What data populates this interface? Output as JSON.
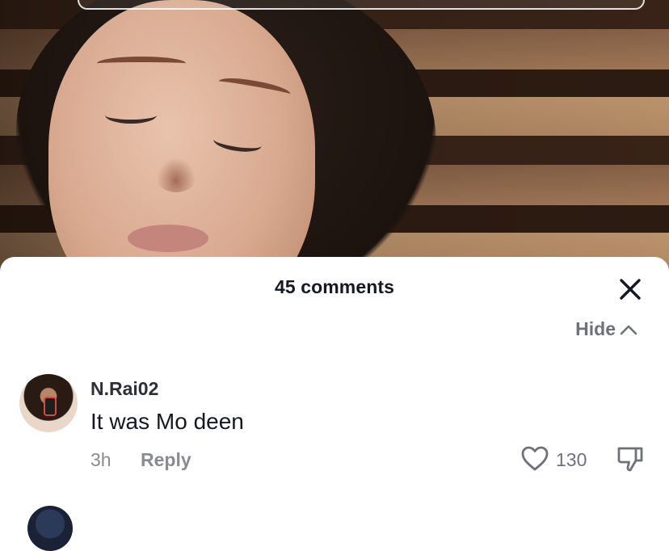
{
  "panel": {
    "title": "45 comments",
    "hide_label": "Hide"
  },
  "comments": [
    {
      "username": "N.Rai02",
      "text": "It was Mo deen",
      "time": "3h",
      "reply_label": "Reply",
      "likes": "130"
    }
  ],
  "icons": {
    "close": "close-icon",
    "hide": "chevron-up-icon",
    "like": "heart-outline-icon",
    "dislike": "thumbs-down-icon"
  },
  "colors": {
    "text_primary": "#161823",
    "text_secondary": "#8a8b91",
    "panel_bg": "#ffffff"
  }
}
